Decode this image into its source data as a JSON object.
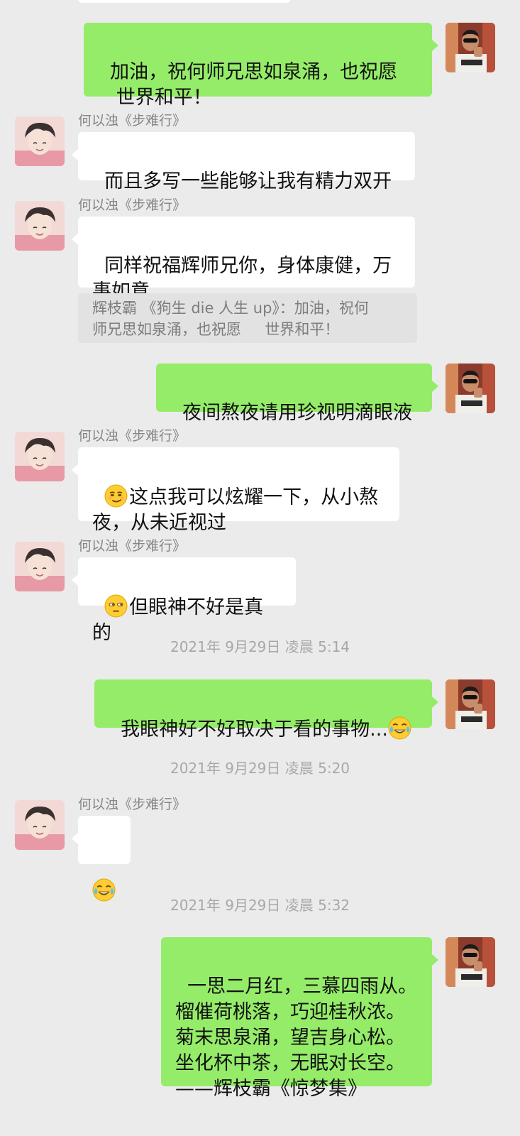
{
  "contact": {
    "name": "何以浊《步难行》"
  },
  "self": {
    "name": "辉枝霸 《狗生 die 人生 up》"
  },
  "messages": [
    {
      "text": "加油，祝何师兄思如泉涌，也祝愿\n   世界和平！"
    },
    {
      "text": "而且多写一些能够让我有精力双开"
    },
    {
      "text": "同样祝福辉师兄你，身体康健，万\n事如意",
      "quote": "辉枝霸 《狗生 die 人生 up》：加油，祝何\n师兄思如泉涌，也祝愿     世界和平！"
    },
    {
      "text": "夜间熬夜请用珍视明滴眼液"
    },
    {
      "text": "这点我可以炫耀一下，从小熬\n夜，从未近视过",
      "emoji": "smirk-emoji"
    },
    {
      "text": "但眼神不好是真的",
      "emoji": "unamused-emoji"
    },
    {
      "time": "2021年 9月29日 凌晨 5:14"
    },
    {
      "text": "我眼神好不好取决于看的事物...",
      "emoji": "tears-of-joy-emoji"
    },
    {
      "time": "2021年 9月29日 凌晨 5:20"
    },
    {
      "text": "",
      "emoji": "tears-of-joy-emoji"
    },
    {
      "time": "2021年 9月29日 凌晨 5:32"
    },
    {
      "text": "一思二月红，三慕四雨从。\n榴催荷桃落，巧迎桂秋浓。\n菊末思泉涌，望吉身心松。\n坐化杯中茶，无眠对长空。\n——辉枝霸《惊梦集》"
    }
  ],
  "colors": {
    "background": "#ebebeb",
    "outgoing_bubble": "#95ec69",
    "incoming_bubble": "#ffffff",
    "quote_background": "#e2e2e2",
    "name_text": "#858585",
    "time_text": "#a8a8a8"
  }
}
